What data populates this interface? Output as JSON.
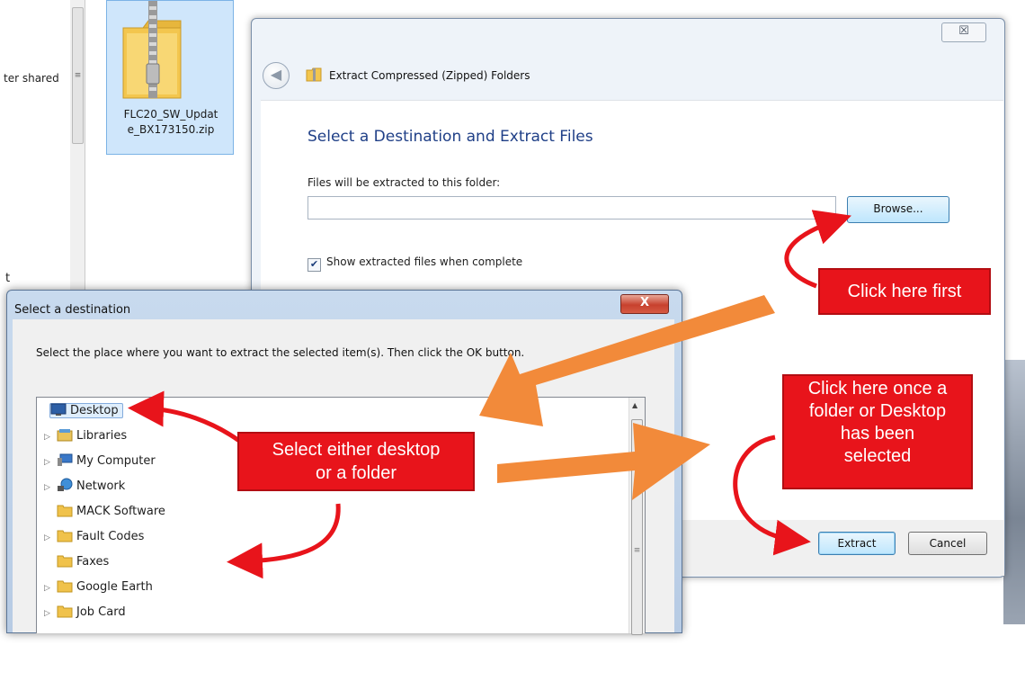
{
  "background": {
    "left_pane_text": "ter shared",
    "left_pane_letter": "t",
    "scroll_grip": "≡",
    "zip_file_label": "FLC20_SW_Update_BX173150.zip",
    "zip_file_label_line1": "FLC20_SW_Updat",
    "zip_file_label_line2": "e_BX173150.zip"
  },
  "wizard": {
    "title": "Extract Compressed (Zipped) Folders",
    "close_label": "☒",
    "back_label": "◀",
    "heading": "Select a Destination and Extract Files",
    "path_label": "Files will be extracted to this folder:",
    "path_value": "",
    "browse_label": "Browse...",
    "show_files_label": "Show extracted files when complete",
    "show_files_checked": true,
    "check_mark": "✔",
    "extract_label": "Extract",
    "cancel_label": "Cancel"
  },
  "destination_dialog": {
    "title": "Select a destination",
    "close_label": "X",
    "instruction": "Select the place where you want to extract the selected item(s).  Then click the OK button.",
    "tree_items": [
      {
        "label": "Desktop",
        "expandable": false,
        "icon": "desktop-icon",
        "selected": true
      },
      {
        "label": "Libraries",
        "expandable": true,
        "icon": "libraries-icon"
      },
      {
        "label": "My Computer",
        "expandable": true,
        "icon": "computer-icon"
      },
      {
        "label": "Network",
        "expandable": true,
        "icon": "network-icon"
      },
      {
        "label": "MACK Software",
        "expandable": false,
        "icon": "folder-icon"
      },
      {
        "label": "Fault Codes",
        "expandable": true,
        "icon": "folder-icon"
      },
      {
        "label": "Faxes",
        "expandable": false,
        "icon": "folder-icon"
      },
      {
        "label": "Google Earth",
        "expandable": true,
        "icon": "folder-icon"
      },
      {
        "label": "Job Card",
        "expandable": true,
        "icon": "folder-icon"
      }
    ],
    "expand_arrow": "▷",
    "scroll_up": "▲",
    "scroll_grip": "≡"
  },
  "callouts": {
    "click_first": "Click here first",
    "click_extract_lines": [
      "Click here once a",
      "folder or Desktop",
      "has been",
      "selected"
    ],
    "select_lines": [
      "Select either desktop",
      "or a folder"
    ]
  },
  "colors": {
    "callout_red": "#e8141b",
    "arrow_orange": "#f28a3a",
    "heading_blue": "#1f3f87"
  }
}
